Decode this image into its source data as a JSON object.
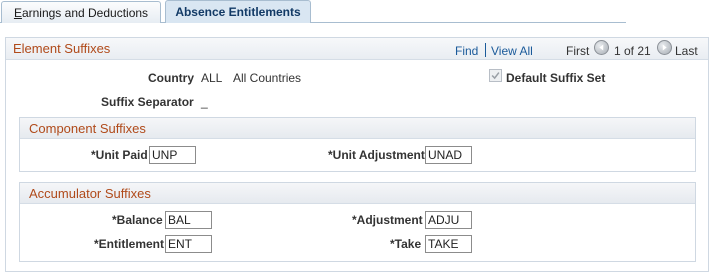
{
  "tabs": [
    {
      "label_first": "E",
      "label_rest": "arnings and Deductions",
      "selected": false
    },
    {
      "label": "Absence Entitlements",
      "selected": true
    }
  ],
  "grid": {
    "title": "Element Suffixes",
    "find_label": "Find",
    "view_all_label": "View All",
    "first_label": "First",
    "page_info": "1 of 21",
    "last_label": "Last"
  },
  "summary": {
    "country_label": "Country",
    "country_code": "ALL",
    "country_name": "All Countries",
    "default_suffix_label": "Default Suffix Set",
    "default_suffix_checked": true,
    "separator_label": "Suffix Separator",
    "separator_value": "_"
  },
  "component": {
    "title": "Component Suffixes",
    "unit_paid_label": "*Unit Paid",
    "unit_paid_value": "UNP",
    "unit_adjustment_label": "*Unit Adjustment",
    "unit_adjustment_value": "UNAD"
  },
  "accumulator": {
    "title": "Accumulator Suffixes",
    "balance_label": "*Balance",
    "balance_value": "BAL",
    "adjustment_label": "*Adjustment",
    "adjustment_value": "ADJU",
    "entitlement_label": "*Entitlement",
    "entitlement_value": "ENT",
    "take_label": "*Take",
    "take_value": "TAKE"
  },
  "icons": {
    "prev": "arrow-left-icon",
    "next": "arrow-right-icon",
    "check": "checkmark-icon"
  },
  "colors": {
    "section_title": "#b04a1a",
    "link": "#1a5a9a",
    "selected_tab": "#d9e6f2"
  }
}
